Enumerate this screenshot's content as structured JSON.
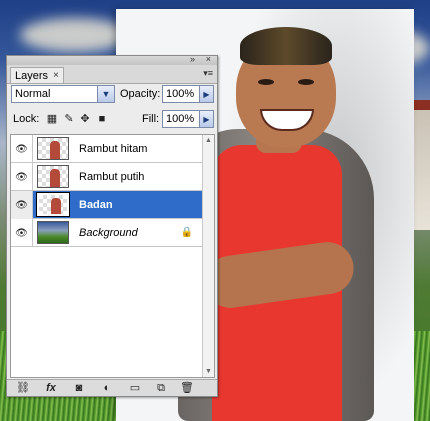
{
  "panel": {
    "tab_label": "Layers",
    "tab_close": "×",
    "title_buttons": {
      "collapse": "»",
      "close": "×"
    },
    "blend_mode": "Normal",
    "opacity_label": "Opacity:",
    "opacity_value": "100%",
    "lock_label": "Lock:",
    "fill_label": "Fill:",
    "fill_value": "100%"
  },
  "layers": [
    {
      "name": "Rambut hitam",
      "visible": true,
      "selected": false,
      "locked": false
    },
    {
      "name": "Rambut putih",
      "visible": true,
      "selected": false,
      "locked": false
    },
    {
      "name": "Badan",
      "visible": true,
      "selected": true,
      "locked": false
    },
    {
      "name": "Background",
      "visible": true,
      "selected": false,
      "locked": true
    }
  ],
  "bottom_icons": [
    "link-layers-icon",
    "fx-icon",
    "add-mask-icon",
    "adjustment-layer-icon",
    "new-group-icon",
    "new-layer-icon",
    "delete-layer-icon"
  ],
  "bottom_labels": {
    "fx": "fx"
  },
  "colors": {
    "selected_row": "#2f6bc8",
    "panel_bg": "#ececec"
  }
}
